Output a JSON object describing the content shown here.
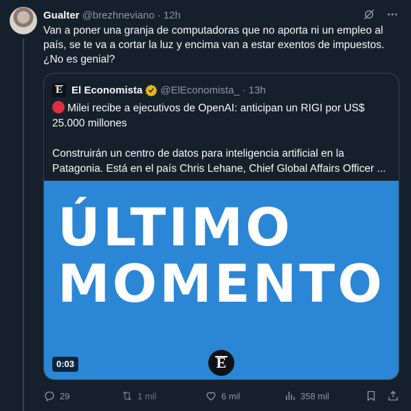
{
  "author": {
    "name": "Gualter",
    "handle": "@brezhneviano",
    "separator": "·",
    "time": "12h"
  },
  "tweet_text": "Van a poner una granja de computadoras que no aporta ni un empleo al país, se te va a cortar la luz y encima van a estar exentos de impuestos. ¿No es genial?",
  "quote": {
    "logo_letter": "E",
    "name": "El Economista",
    "handle": "@ElEconomista_",
    "separator": "·",
    "time": "13h",
    "headline": "Milei recibe a ejecutivos de OpenAI: anticipan un RIGI por US$ 25.000 millones",
    "body": "Construirán un centro de datos para inteligencia artificial en la Patagonia. Está en el país Chris Lehane, Chief Global Affairs Officer ...",
    "media": {
      "line1": "ÚLTIMO",
      "line2": "MOMENTO",
      "logo_letter": "E",
      "duration": "0:03",
      "background": "#2c86d6"
    }
  },
  "actions": {
    "replies": "29",
    "retweets": "1 mil",
    "likes": "6 mil",
    "views": "358 mil"
  },
  "colors": {
    "background": "#15202b",
    "text": "#f7f9f9",
    "muted": "#8b98a5",
    "border": "#38444d",
    "verified_gold": "#e2b719",
    "live_red": "#dd2e44"
  },
  "icons": [
    "grok-icon",
    "more-icon",
    "verified-badge-icon",
    "reply-icon",
    "retweet-icon",
    "like-icon",
    "views-icon",
    "bookmark-icon",
    "share-icon"
  ]
}
